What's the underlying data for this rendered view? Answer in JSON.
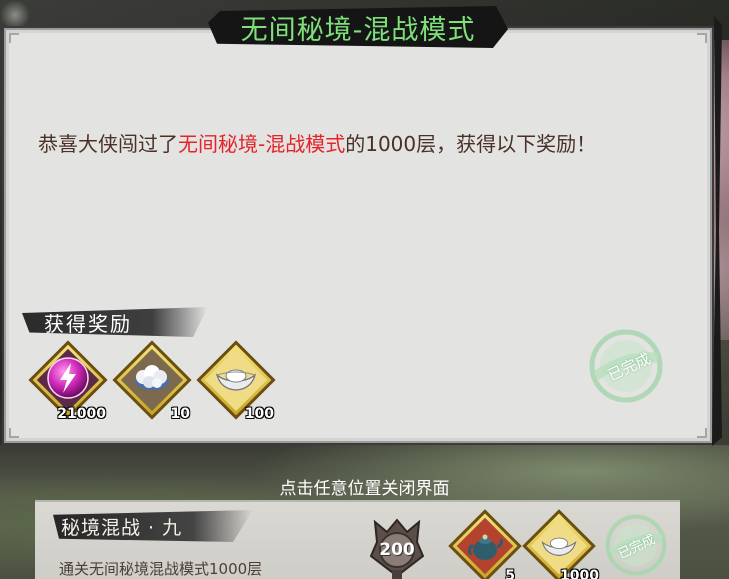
{
  "dialog": {
    "title": "无间秘境-混战模式",
    "message_prefix": "恭喜大侠闯过了",
    "message_highlight": "无间秘境-混战模式",
    "message_suffix": "的1000层，获得以下奖励！",
    "reward_section_label": "获得奖励",
    "rewards": [
      {
        "icon": "purple-energy-orb-icon",
        "count": "21000"
      },
      {
        "icon": "white-ore-icon",
        "count": "10"
      },
      {
        "icon": "silver-ingot-icon",
        "count": "100"
      }
    ],
    "seal_text": "已完成"
  },
  "close_hint": "点击任意位置关闭界面",
  "achievement": {
    "title": "秘境混战 · 九",
    "description": "通关无间秘境混战模式1000层",
    "points": "200",
    "rewards": [
      {
        "icon": "teapot-icon",
        "count": "5"
      },
      {
        "icon": "silver-ingot-icon",
        "count": "1000"
      }
    ],
    "seal_text": "已完成"
  },
  "colors": {
    "title_green": "#7fe07a",
    "highlight_red": "#e5242a",
    "text_brown": "#4a3027",
    "seal_green": "#8fc79a"
  }
}
